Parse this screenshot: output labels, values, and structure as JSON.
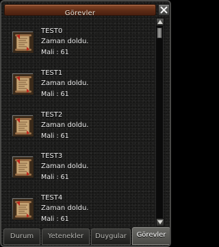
{
  "window": {
    "title": "Görevler"
  },
  "quests": [
    {
      "name": "TEST0",
      "status": "Zaman doldu.",
      "reward": "Mali : 61",
      "icon": "quest-scroll-icon"
    },
    {
      "name": "TEST1",
      "status": "Zaman doldu.",
      "reward": "Mali : 61",
      "icon": "quest-scroll-icon"
    },
    {
      "name": "TEST2",
      "status": "Zaman doldu.",
      "reward": "Mali : 61",
      "icon": "quest-scroll-icon"
    },
    {
      "name": "TEST3",
      "status": "Zaman doldu.",
      "reward": "Mali : 61",
      "icon": "quest-scroll-icon"
    },
    {
      "name": "TEST4",
      "status": "Zaman doldu.",
      "reward": "Mali : 61",
      "icon": "quest-scroll-icon"
    }
  ],
  "tabs": [
    {
      "label": "Durum"
    },
    {
      "label": "Yetenekler"
    },
    {
      "label": "Duygular"
    },
    {
      "label": "Görevler",
      "active": true
    }
  ],
  "colors": {
    "title_bar": "#6a3520",
    "text": "#ececec",
    "scroll_seal": "#c0281e"
  },
  "icons": {
    "close": "close-icon",
    "scroll_up": "arrow-up-icon",
    "scroll_down": "arrow-down-icon"
  }
}
